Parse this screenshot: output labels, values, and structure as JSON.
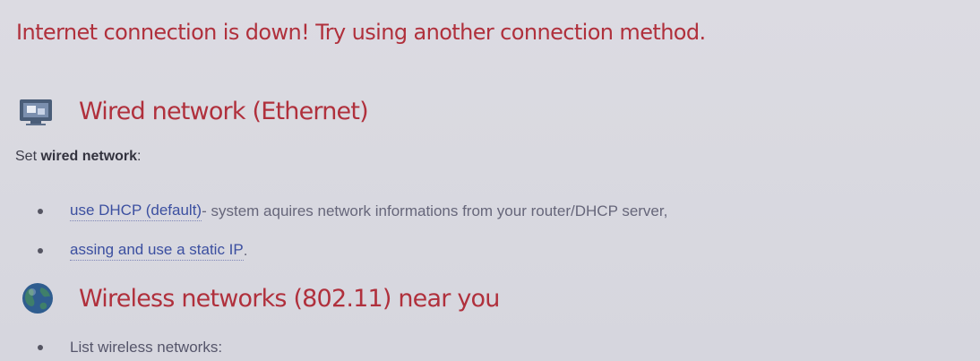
{
  "alert": {
    "message": "Internet connection is down! Try using another connection method."
  },
  "wired": {
    "icon": "ethernet-monitor-icon",
    "title": "Wired network (Ethernet)",
    "intro_prefix": "Set ",
    "intro_bold": "wired network",
    "intro_suffix": ":",
    "options": [
      {
        "link": "use DHCP (default)",
        "description": " - system aquires network informations from your router/DHCP server,"
      },
      {
        "link": "assing and use a static IP",
        "description": "."
      }
    ]
  },
  "wireless": {
    "icon": "globe-icon",
    "title": "Wireless networks (802.11) near you",
    "items": [
      {
        "label": "List wireless networks:"
      }
    ]
  },
  "colors": {
    "alert_text": "#b0303c",
    "link_text": "#3b4fa0",
    "background": "#d9d9e0"
  }
}
